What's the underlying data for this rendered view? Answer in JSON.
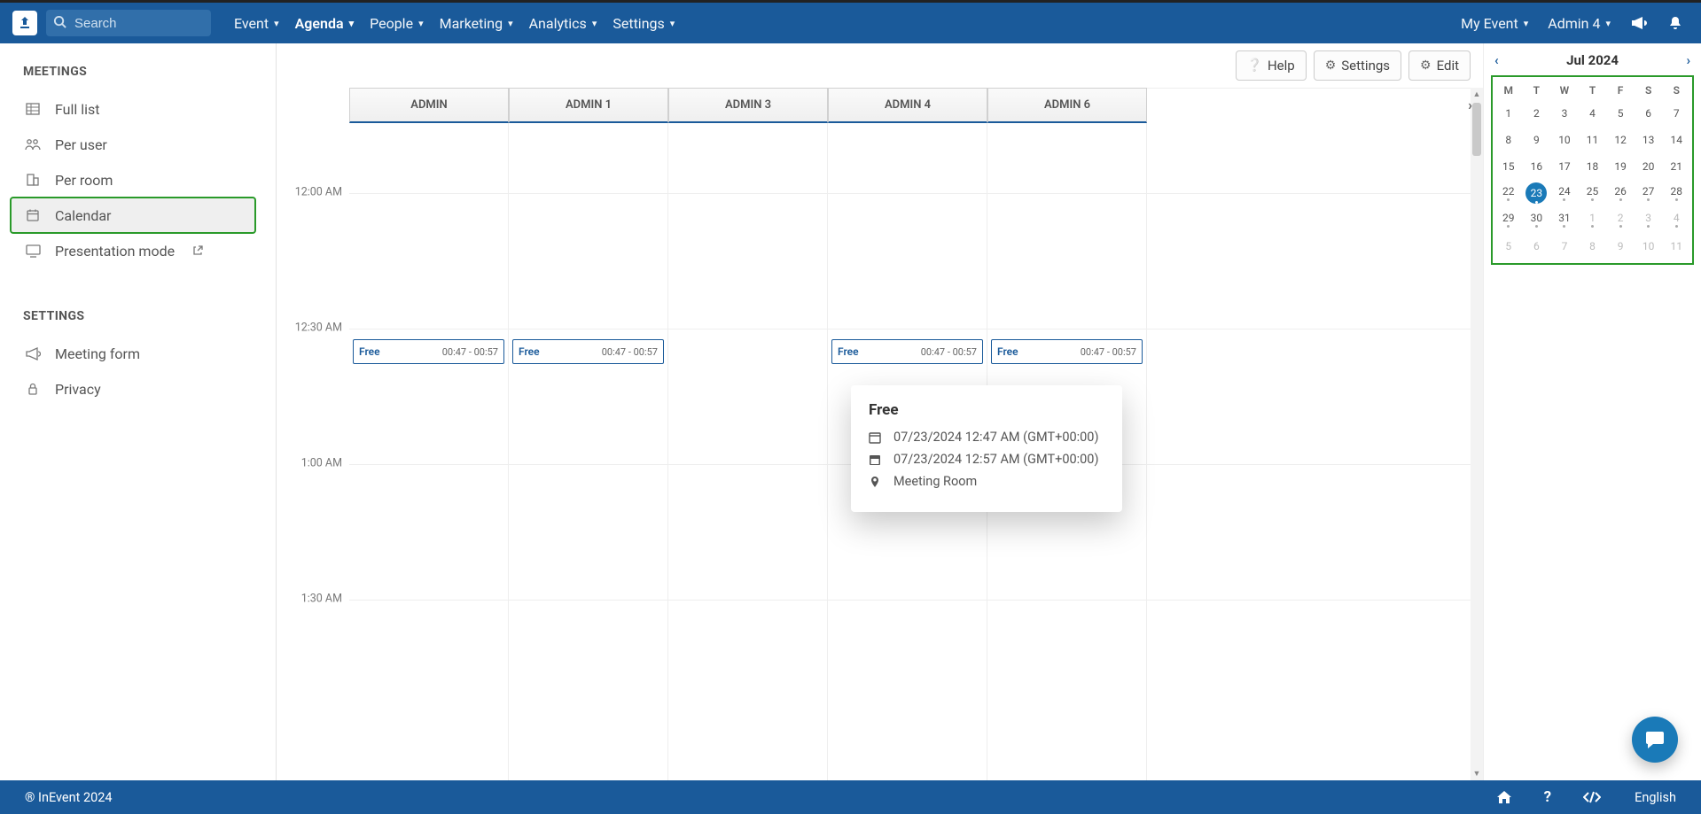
{
  "header": {
    "search_placeholder": "Search",
    "nav": [
      "Event",
      "Agenda",
      "People",
      "Marketing",
      "Analytics",
      "Settings"
    ],
    "active_nav_index": 1,
    "my_event": "My Event",
    "user": "Admin 4"
  },
  "toolbar": {
    "help": "Help",
    "settings": "Settings",
    "edit": "Edit"
  },
  "sidebar": {
    "meetings_title": "MEETINGS",
    "items": [
      "Full list",
      "Per user",
      "Per room",
      "Calendar",
      "Presentation mode"
    ],
    "selected_index": 3,
    "settings_title": "SETTINGS",
    "settings_items": [
      "Meeting form",
      "Privacy"
    ]
  },
  "calendar": {
    "resources": [
      "ADMIN",
      "ADMIN 1",
      "ADMIN 3",
      "ADMIN 4",
      "ADMIN 6"
    ],
    "time_labels": [
      "12:00 AM",
      "12:30 AM",
      "1:00 AM",
      "1:30 AM"
    ],
    "slots": [
      {
        "col": 0,
        "label": "Free",
        "time": "00:47 - 00:57"
      },
      {
        "col": 1,
        "label": "Free",
        "time": "00:47 - 00:57"
      },
      {
        "col": 3,
        "label": "Free",
        "time": "00:47 - 00:57"
      },
      {
        "col": 4,
        "label": "Free",
        "time": "00:47 - 00:57"
      }
    ]
  },
  "popup": {
    "title": "Free",
    "start": "07/23/2024 12:47 AM (GMT+00:00)",
    "end": "07/23/2024 12:57 AM (GMT+00:00)",
    "room": "Meeting Room"
  },
  "minical": {
    "month": "Jul 2024",
    "dow": [
      "M",
      "T",
      "W",
      "T",
      "F",
      "S",
      "S"
    ],
    "rows": [
      [
        {
          "n": "1"
        },
        {
          "n": "2"
        },
        {
          "n": "3"
        },
        {
          "n": "4"
        },
        {
          "n": "5"
        },
        {
          "n": "6"
        },
        {
          "n": "7"
        }
      ],
      [
        {
          "n": "8"
        },
        {
          "n": "9"
        },
        {
          "n": "10"
        },
        {
          "n": "11"
        },
        {
          "n": "12"
        },
        {
          "n": "13"
        },
        {
          "n": "14"
        }
      ],
      [
        {
          "n": "15"
        },
        {
          "n": "16"
        },
        {
          "n": "17"
        },
        {
          "n": "18"
        },
        {
          "n": "19"
        },
        {
          "n": "20"
        },
        {
          "n": "21"
        }
      ],
      [
        {
          "n": "22",
          "d": true
        },
        {
          "n": "23",
          "sel": true,
          "d": true
        },
        {
          "n": "24",
          "d": true
        },
        {
          "n": "25",
          "d": true
        },
        {
          "n": "26",
          "d": true
        },
        {
          "n": "27",
          "d": true
        },
        {
          "n": "28",
          "d": true
        }
      ],
      [
        {
          "n": "29",
          "d": true
        },
        {
          "n": "30",
          "d": true
        },
        {
          "n": "31",
          "d": true
        },
        {
          "n": "1",
          "m": true,
          "d": true
        },
        {
          "n": "2",
          "m": true,
          "d": true
        },
        {
          "n": "3",
          "m": true,
          "d": true
        },
        {
          "n": "4",
          "m": true,
          "d": true
        }
      ],
      [
        {
          "n": "5",
          "m": true
        },
        {
          "n": "6",
          "m": true
        },
        {
          "n": "7",
          "m": true
        },
        {
          "n": "8",
          "m": true
        },
        {
          "n": "9",
          "m": true
        },
        {
          "n": "10",
          "m": true
        },
        {
          "n": "11",
          "m": true
        }
      ]
    ]
  },
  "footer": {
    "copyright": "® InEvent 2024",
    "lang": "English"
  }
}
